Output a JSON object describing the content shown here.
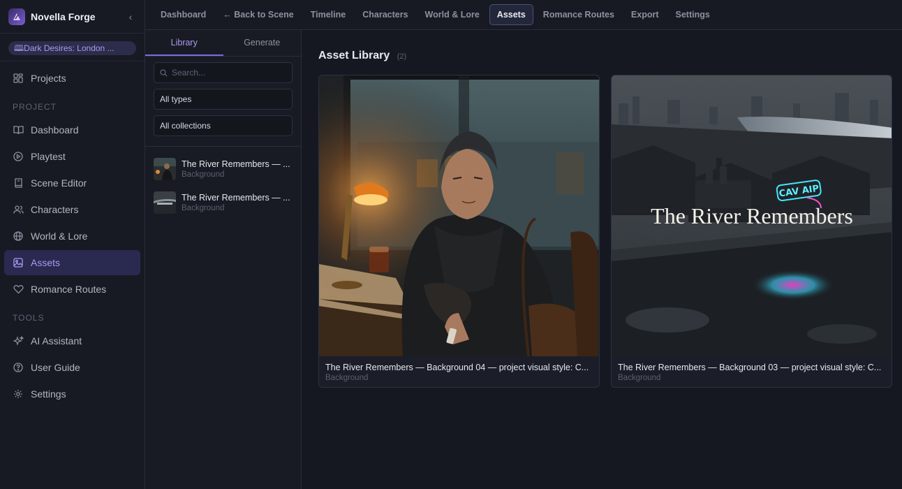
{
  "app": {
    "name": "Novella Forge"
  },
  "sidebar": {
    "project_pill": "Dark Desires: London ...",
    "top_item": {
      "label": "Projects",
      "icon": "grid-icon"
    },
    "project_section": "PROJECT",
    "project_items": [
      {
        "label": "Dashboard",
        "icon": "book-open-icon"
      },
      {
        "label": "Playtest",
        "icon": "play-circle-icon"
      },
      {
        "label": "Scene Editor",
        "icon": "book-icon"
      },
      {
        "label": "Characters",
        "icon": "users-icon"
      },
      {
        "label": "World & Lore",
        "icon": "globe-icon"
      },
      {
        "label": "Assets",
        "icon": "image-icon",
        "active": true
      },
      {
        "label": "Romance Routes",
        "icon": "heart-icon"
      }
    ],
    "tools_section": "TOOLS",
    "tools_items": [
      {
        "label": "AI Assistant",
        "icon": "sparkles-icon"
      },
      {
        "label": "User Guide",
        "icon": "help-circle-icon"
      },
      {
        "label": "Settings",
        "icon": "gear-icon"
      }
    ]
  },
  "topnav": {
    "items": [
      "Dashboard",
      "← Back to Scene",
      "Timeline",
      "Characters",
      "World & Lore",
      "Assets",
      "Romance Routes",
      "Export",
      "Settings"
    ],
    "active": "Assets"
  },
  "panel": {
    "tabs": [
      "Library",
      "Generate"
    ],
    "active_tab": "Library",
    "search_placeholder": "Search...",
    "type_filter": "All types",
    "collection_filter": "All collections",
    "items": [
      {
        "title": "The River Remembers — ...",
        "type": "Background"
      },
      {
        "title": "The River Remembers — ...",
        "type": "Background"
      }
    ]
  },
  "gallery": {
    "title": "Asset Library",
    "count": "(2)",
    "cards": [
      {
        "title": "The River Remembers — Background 04 — project visual style: C...",
        "type": "Background"
      },
      {
        "title": "The River Remembers — Background 03 — project visual style: C...",
        "type": "Background",
        "overlay_text": "The River Remembers",
        "neon_text": "CAV AIP"
      }
    ]
  },
  "colors": {
    "accent": "#a99bf0",
    "active_bg": "#2a2950",
    "bg": "#151821"
  }
}
